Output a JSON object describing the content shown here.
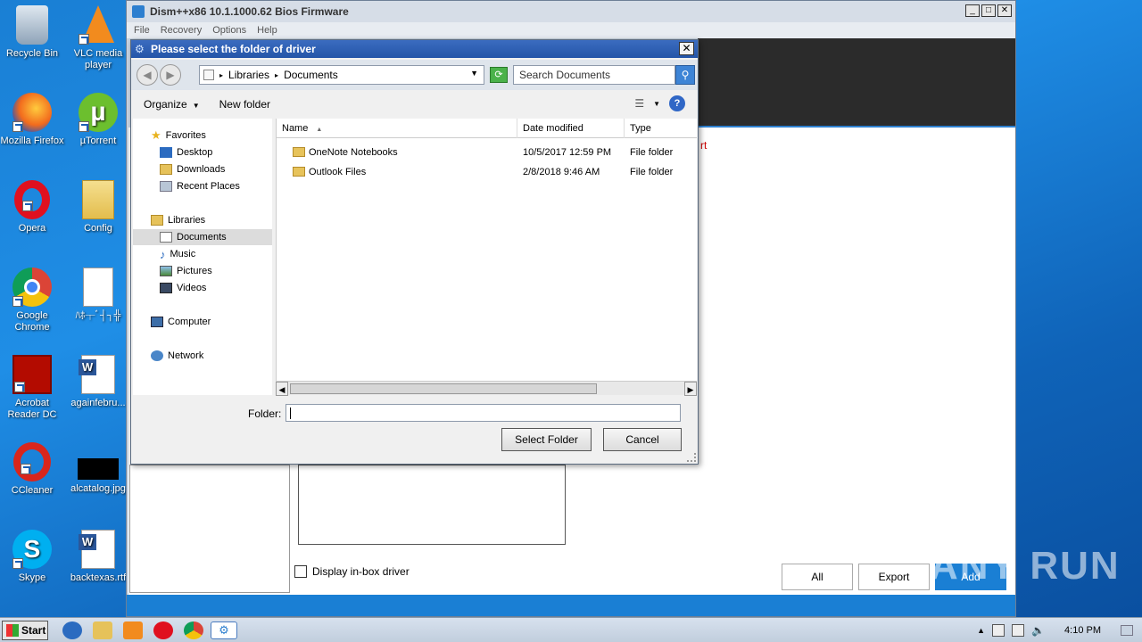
{
  "desktop": {
    "icons": [
      {
        "label": "Recycle Bin"
      },
      {
        "label": "VLC media player"
      },
      {
        "label": "Mozilla Firefox"
      },
      {
        "label": "µTorrent"
      },
      {
        "label": "Opera"
      },
      {
        "label": "Config"
      },
      {
        "label": "Google Chrome"
      },
      {
        "label": "ﾊﾎ┬ﾞ┤┐╬"
      },
      {
        "label": "Acrobat Reader DC"
      },
      {
        "label": "againfebru..."
      },
      {
        "label": "CCleaner"
      },
      {
        "label": "alcatalog.jpg"
      },
      {
        "label": "Skype"
      },
      {
        "label": "backtexas.rtf"
      }
    ]
  },
  "dism": {
    "title": "Dism++x86 10.1.1000.62 Bios Firmware",
    "menu": [
      "File",
      "Recovery",
      "Options",
      "Help"
    ],
    "red_text": "rt",
    "checkbox_label": "Display in-box driver",
    "buttons": {
      "all": "All",
      "export": "Export",
      "add": "Add"
    }
  },
  "dialog": {
    "title": "Please select the folder of driver",
    "close": "✕",
    "breadcrumb": [
      "Libraries",
      "Documents"
    ],
    "search_placeholder": "Search Documents",
    "toolbar": {
      "organize": "Organize",
      "new_folder": "New folder"
    },
    "nav": {
      "favorites": "Favorites",
      "desktop": "Desktop",
      "downloads": "Downloads",
      "recent": "Recent Places",
      "libraries": "Libraries",
      "documents": "Documents",
      "music": "Music",
      "pictures": "Pictures",
      "videos": "Videos",
      "computer": "Computer",
      "network": "Network"
    },
    "columns": {
      "name": "Name",
      "date": "Date modified",
      "type": "Type"
    },
    "files": [
      {
        "name": "OneNote Notebooks",
        "date": "10/5/2017 12:59 PM",
        "type": "File folder"
      },
      {
        "name": "Outlook Files",
        "date": "2/8/2018 9:46 AM",
        "type": "File folder"
      }
    ],
    "folder_label": "Folder:",
    "folder_value": "",
    "select_button": "Select Folder",
    "cancel_button": "Cancel"
  },
  "taskbar": {
    "start": "Start",
    "clock": "4:10 PM"
  },
  "watermark": "ANY RUN"
}
